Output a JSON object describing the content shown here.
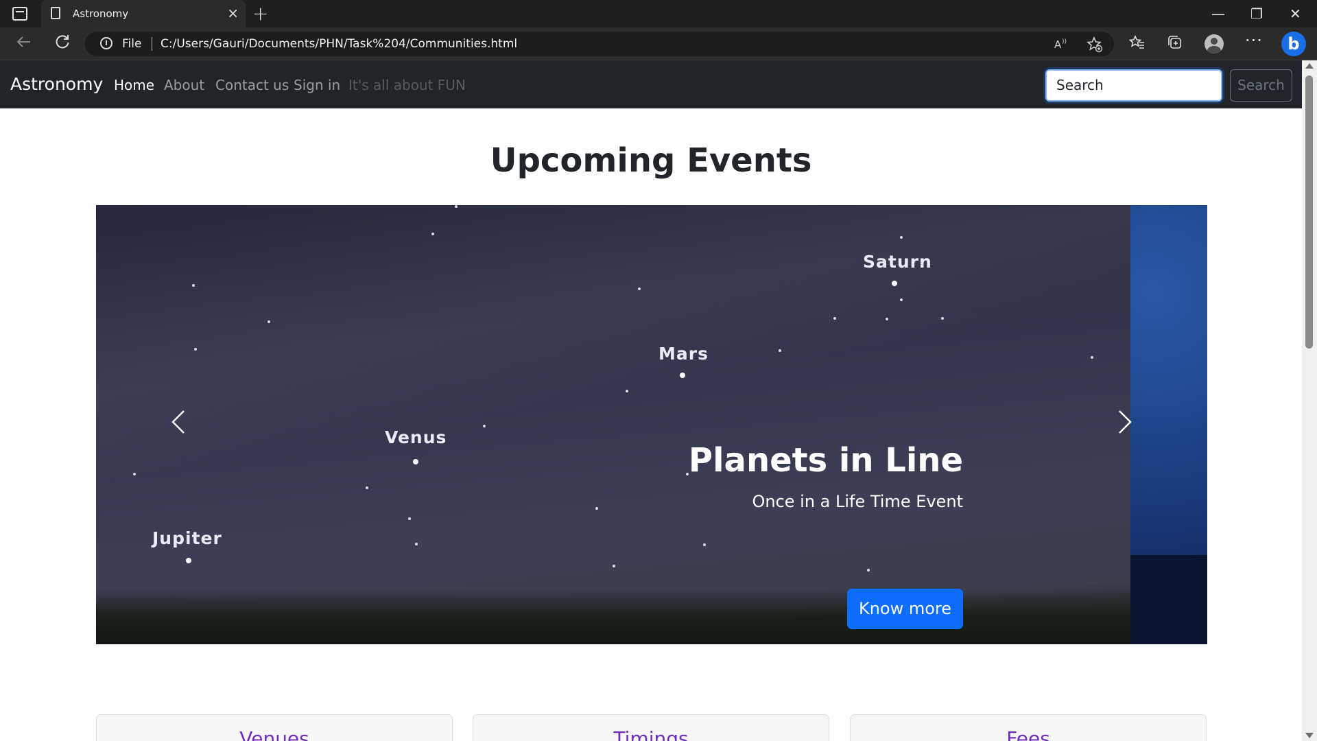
{
  "browser": {
    "tab_title": "Astronomy",
    "tab_close": "×",
    "new_tab": "+",
    "window_controls": [
      "—",
      "❐",
      "✕"
    ],
    "file_label": "File",
    "url": "C:/Users/Gauri/Documents/PHN/Task%204/Communities.html",
    "icons": [
      "tab-actions-icon",
      "page-icon",
      "back-icon",
      "refresh-icon",
      "info-icon",
      "read-aloud-icon",
      "add-favorite-icon",
      "favorites-icon",
      "collections-icon",
      "profile-icon",
      "more-icon",
      "bing-icon"
    ]
  },
  "site_nav": {
    "brand": "Astronomy",
    "links": [
      "Home",
      "About",
      "Contact us",
      "Sign in",
      "It's all about FUN"
    ],
    "search_placeholder": "Search",
    "search_button": "Search"
  },
  "main": {
    "heading": "Upcoming Events",
    "carousel": {
      "planets": [
        "Saturn",
        "Mars",
        "Venus",
        "Jupiter"
      ],
      "caption_title": "Planets in Line",
      "caption_subtitle": "Once in a Life Time Event",
      "button": "Know more",
      "active_indicator": 3,
      "indicator_count": 3
    },
    "cards": [
      "Venues",
      "Timings",
      "Fees"
    ]
  },
  "colors": {
    "navbar": "#212529",
    "primary": "#0d6efd",
    "card_title": "#6f2dbd"
  }
}
